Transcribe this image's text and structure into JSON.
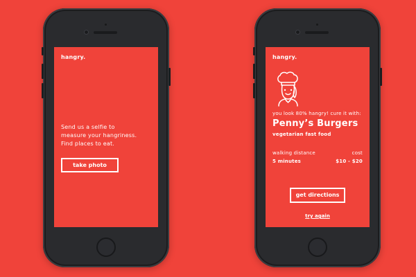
{
  "background_color": "#f0433a",
  "left_screen": {
    "logo": "hangry.",
    "intro_text": "Send us a selfie to\nmeasure your hangriness.\nFind places to eat.",
    "take_photo_label": "take photo"
  },
  "right_screen": {
    "logo": "hangry.",
    "avatar_icon": "chef-icon",
    "status_text": "you look 80% hangry! cure it with:",
    "restaurant_name": "Penny’s Burgers",
    "restaurant_type": "vegetarian fast food",
    "distance_label": "walking distance",
    "distance_value": "5 minutes",
    "cost_label": "cost",
    "cost_value": "$10 - $20",
    "get_directions_label": "get directions",
    "try_again_label": "try again"
  }
}
